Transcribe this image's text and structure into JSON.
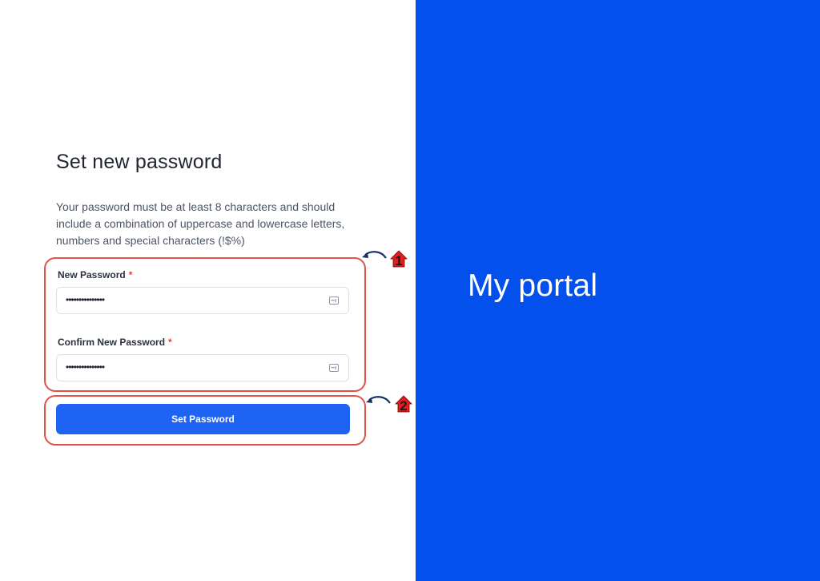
{
  "brand": {
    "text": "My portal",
    "color": "#0450EC"
  },
  "form": {
    "title": "Set new password",
    "description": "Your password must be at least 8 characters and should include a combination of uppercase and lowercase letters, numbers and special characters (!$%)",
    "new_password": {
      "label": "New Password",
      "required_mark": "*",
      "value": "•••••••••••••••"
    },
    "confirm_password": {
      "label": "Confirm New Password",
      "required_mark": "*",
      "value": "•••••••••••••••"
    },
    "submit_label": "Set Password",
    "button_color": "#1F63F4"
  },
  "annotations": {
    "marker1": "1",
    "marker2": "2",
    "highlight_color": "#E0524A"
  }
}
